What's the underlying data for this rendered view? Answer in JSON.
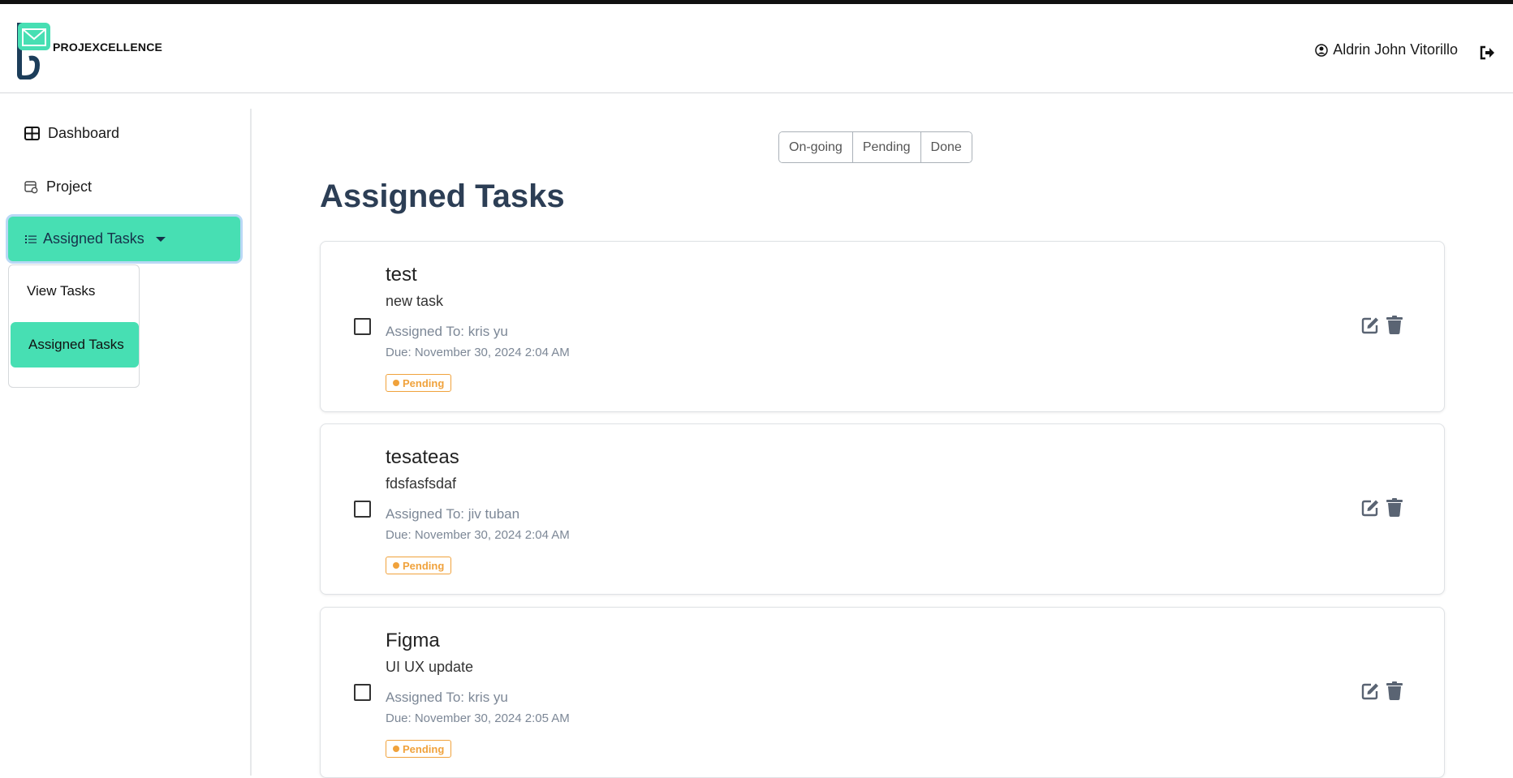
{
  "header": {
    "brand": "PROJEXCELLENCE",
    "user_name": "Aldrin John Vitorillo"
  },
  "sidebar": {
    "items": [
      {
        "label": "Dashboard",
        "icon": "grid-icon"
      },
      {
        "label": "Project",
        "icon": "calendar-icon"
      },
      {
        "label": "Assigned Tasks",
        "icon": "list-icon"
      }
    ],
    "dropdown": [
      {
        "label": "View Tasks"
      },
      {
        "label": "Assigned Tasks"
      }
    ]
  },
  "filters": [
    "On-going",
    "Pending",
    "Done"
  ],
  "main": {
    "title": "Assigned Tasks",
    "tasks": [
      {
        "title": "test",
        "description": "new task",
        "assigned": "Assigned To: kris yu",
        "due": "Due: November 30, 2024 2:04 AM",
        "status": "Pending"
      },
      {
        "title": "tesateas",
        "description": "fdsfasfsdaf",
        "assigned": "Assigned To: jiv tuban",
        "due": "Due: November 30, 2024 2:04 AM",
        "status": "Pending"
      },
      {
        "title": "Figma",
        "description": "UI UX update",
        "assigned": "Assigned To: kris yu",
        "due": "Due: November 30, 2024 2:05 AM",
        "status": "Pending"
      }
    ]
  },
  "colors": {
    "accent": "#47dfb3",
    "title": "#2c3e55",
    "pending": "#f0a23c",
    "muted": "#7c8796"
  }
}
